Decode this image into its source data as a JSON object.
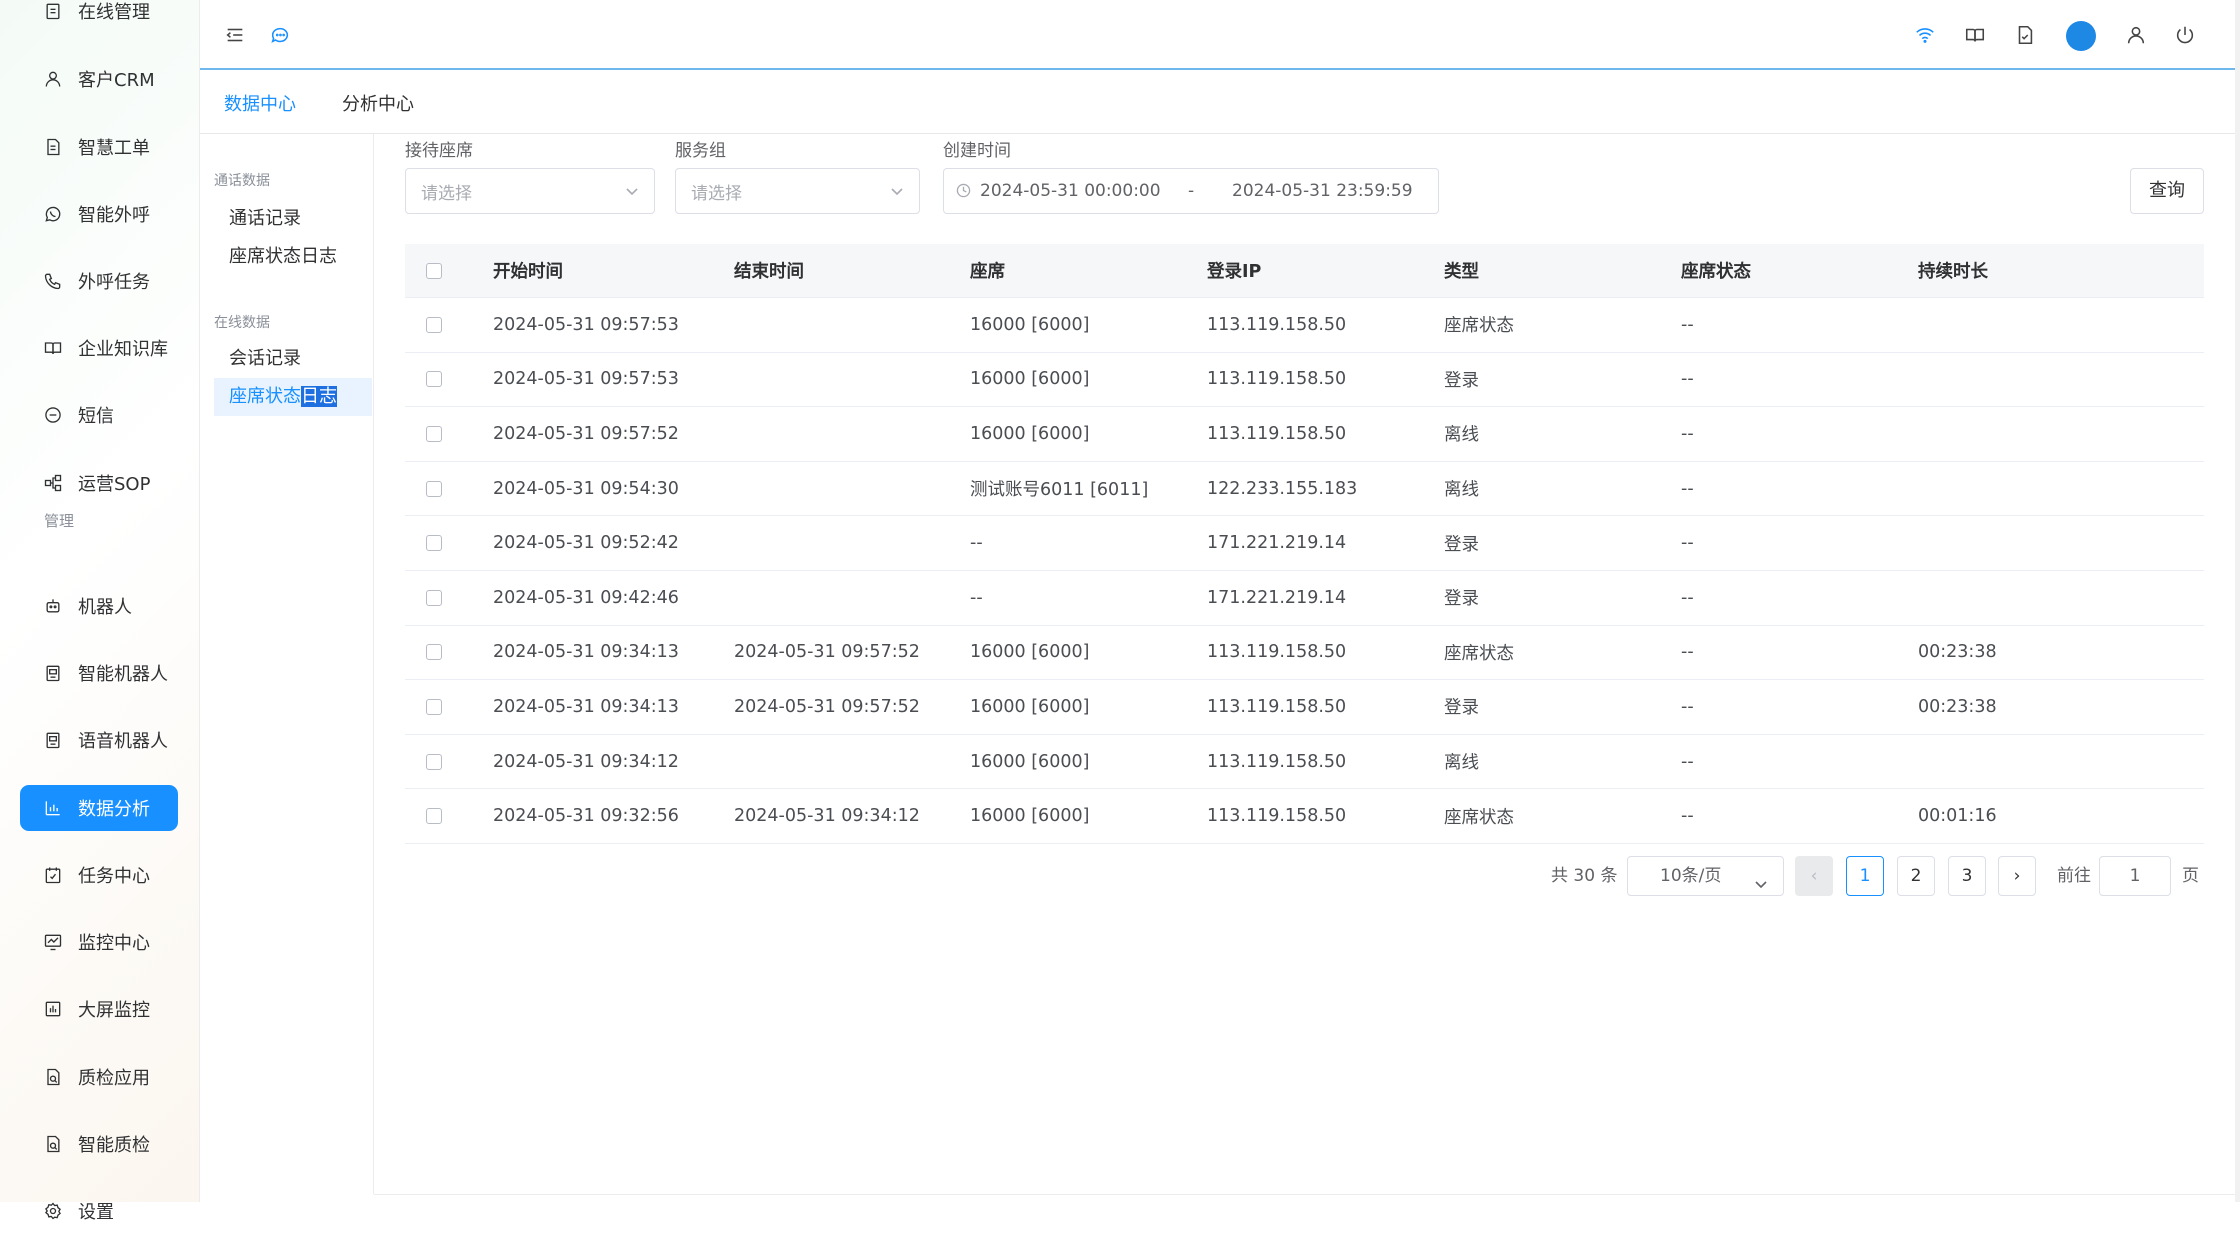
{
  "nav": {
    "items": [
      {
        "key": "online",
        "label": "在线管理",
        "icon": "clipboard-icon"
      },
      {
        "key": "crm",
        "label": "客户CRM",
        "icon": "user-icon"
      },
      {
        "key": "ticket",
        "label": "智慧工单",
        "icon": "document-icon"
      },
      {
        "key": "outbound",
        "label": "智能外呼",
        "icon": "whatsapp-icon"
      },
      {
        "key": "tasks",
        "label": "外呼任务",
        "icon": "phone-icon"
      },
      {
        "key": "kb",
        "label": "企业知识库",
        "icon": "book-icon"
      },
      {
        "key": "sms",
        "label": "短信",
        "icon": "sms-icon"
      },
      {
        "key": "sop",
        "label": "运营SOP",
        "icon": "flow-icon"
      },
      {
        "key": "robot",
        "label": "机器人",
        "icon": "robot-icon"
      },
      {
        "key": "smartbot",
        "label": "智能机器人",
        "icon": "bot-screen-icon"
      },
      {
        "key": "voicebot",
        "label": "语音机器人",
        "icon": "bot-screen-icon"
      },
      {
        "key": "analytics",
        "label": "数据分析",
        "icon": "bar-chart-icon",
        "active": true
      },
      {
        "key": "taskcenter",
        "label": "任务中心",
        "icon": "calendar-check-icon"
      },
      {
        "key": "monitor",
        "label": "监控中心",
        "icon": "monitor-chart-icon"
      },
      {
        "key": "bigscreen",
        "label": "大屏监控",
        "icon": "bar-screen-icon"
      },
      {
        "key": "qa",
        "label": "质检应用",
        "icon": "qa-doc-icon"
      },
      {
        "key": "smartqa",
        "label": "智能质检",
        "icon": "qa-doc-icon"
      },
      {
        "key": "settings",
        "label": "设置",
        "icon": "gear-icon"
      }
    ],
    "section_manage": "管理"
  },
  "topbar": {
    "icons": [
      "menu-fold-icon",
      "chat-icon",
      "wifi-icon",
      "book-open-icon",
      "doc-check-icon",
      "avatar",
      "user-icon",
      "power-icon"
    ]
  },
  "tabs": [
    {
      "label": "数据中心",
      "active": true
    },
    {
      "label": "分析中心",
      "active": false
    }
  ],
  "subnav": {
    "group1": "通话数据",
    "group1_items": [
      "通话记录",
      "座席状态日志"
    ],
    "group2": "在线数据",
    "group2_items": [
      "会话记录",
      "座席状态日志"
    ],
    "active_item_prefix": "座席状态",
    "active_item_selected": "日志"
  },
  "filters": {
    "agent_label": "接待座席",
    "agent_placeholder": "请选择",
    "group_label": "服务组",
    "group_placeholder": "请选择",
    "created_label": "创建时间",
    "date_start": "2024-05-31 00:00:00",
    "date_sep": "-",
    "date_end": "2024-05-31 23:59:59",
    "query_button": "查询"
  },
  "table": {
    "headers": [
      "开始时间",
      "结束时间",
      "座席",
      "登录IP",
      "类型",
      "座席状态",
      "持续时长"
    ],
    "rows": [
      [
        "2024-05-31 09:57:53",
        "",
        "16000 [6000]",
        "113.119.158.50",
        "座席状态",
        "--",
        ""
      ],
      [
        "2024-05-31 09:57:53",
        "",
        "16000 [6000]",
        "113.119.158.50",
        "登录",
        "--",
        ""
      ],
      [
        "2024-05-31 09:57:52",
        "",
        "16000 [6000]",
        "113.119.158.50",
        "离线",
        "--",
        ""
      ],
      [
        "2024-05-31 09:54:30",
        "",
        "测试账号6011 [6011]",
        "122.233.155.183",
        "离线",
        "--",
        ""
      ],
      [
        "2024-05-31 09:52:42",
        "",
        "--",
        "171.221.219.14",
        "登录",
        "--",
        ""
      ],
      [
        "2024-05-31 09:42:46",
        "",
        "--",
        "171.221.219.14",
        "登录",
        "--",
        ""
      ],
      [
        "2024-05-31 09:34:13",
        "2024-05-31 09:57:52",
        "16000 [6000]",
        "113.119.158.50",
        "座席状态",
        "--",
        "00:23:38"
      ],
      [
        "2024-05-31 09:34:13",
        "2024-05-31 09:57:52",
        "16000 [6000]",
        "113.119.158.50",
        "登录",
        "--",
        "00:23:38"
      ],
      [
        "2024-05-31 09:34:12",
        "",
        "16000 [6000]",
        "113.119.158.50",
        "离线",
        "--",
        ""
      ],
      [
        "2024-05-31 09:32:56",
        "2024-05-31 09:34:12",
        "16000 [6000]",
        "113.119.158.50",
        "座席状态",
        "--",
        "00:01:16"
      ]
    ]
  },
  "pagination": {
    "total": "共 30 条",
    "page_size": "10条/页",
    "prev": "‹",
    "pages": [
      "1",
      "2",
      "3"
    ],
    "current": "1",
    "next": "›",
    "goto_label": "前往",
    "goto_value": "1",
    "page_suffix": "页"
  },
  "colors": {
    "accent": "#1890ff",
    "active_bg": "#e8f3ff",
    "topbar_line": "#6fb8ee"
  }
}
